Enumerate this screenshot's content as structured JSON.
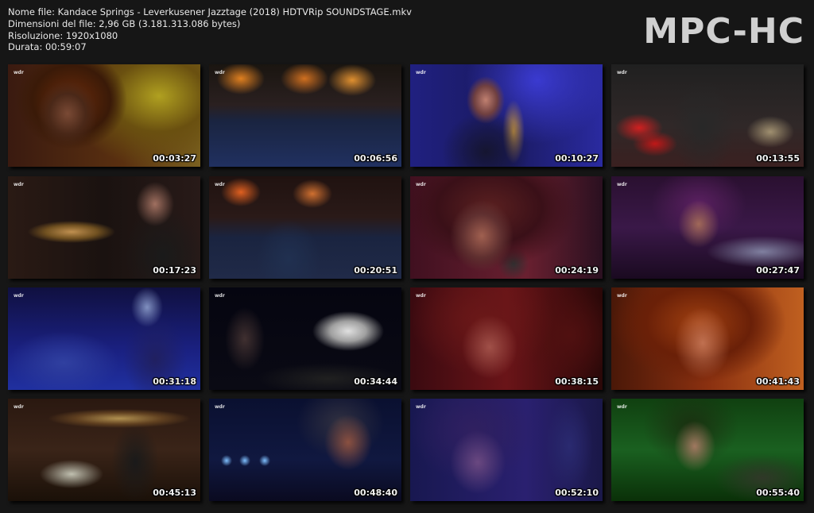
{
  "info": {
    "filename": "Nome file: Kandace Springs - Leverkusener Jazztage (2018) HDTVRip SOUNDSTAGE.mkv",
    "filesize": "Dimensioni del file: 2,96 GB (3.181.313.086 bytes)",
    "resolution": "Risoluzione: 1920x1080",
    "duration": "Durata: 00:59:07"
  },
  "brand": "MPC-HC",
  "thumbnails": [
    {
      "time": "00:03:27",
      "scene": "singer close-up, curly hair, warm yellow-red stage light"
    },
    {
      "time": "00:06:56",
      "scene": "wide shot of stage with audience, orange spotlights"
    },
    {
      "time": "00:10:27",
      "scene": "saxophonist in blue light"
    },
    {
      "time": "00:13:55",
      "scene": "drummer and percussionist, red drums"
    },
    {
      "time": "00:17:23",
      "scene": "trumpeter with glasses, dark background"
    },
    {
      "time": "00:20:51",
      "scene": "wide shot of audience and stage lights"
    },
    {
      "time": "00:24:19",
      "scene": "singer close-up with microphone, red-purple light"
    },
    {
      "time": "00:27:47",
      "scene": "singer at keyboard, purple light"
    },
    {
      "time": "00:31:18",
      "scene": "band with saxophonists, blue light"
    },
    {
      "time": "00:34:44",
      "scene": "singer at grand piano, dark"
    },
    {
      "time": "00:38:15",
      "scene": "singer singing into mic, red light"
    },
    {
      "time": "00:41:43",
      "scene": "singer singing, orange warm light"
    },
    {
      "time": "00:45:13",
      "scene": "trombone player close-up, sheet music"
    },
    {
      "time": "00:48:40",
      "scene": "singer at mic, blue spotlights"
    },
    {
      "time": "00:52:10",
      "scene": "singer close-up, blue-purple light"
    },
    {
      "time": "00:55:40",
      "scene": "singer at keyboard, green light"
    }
  ]
}
